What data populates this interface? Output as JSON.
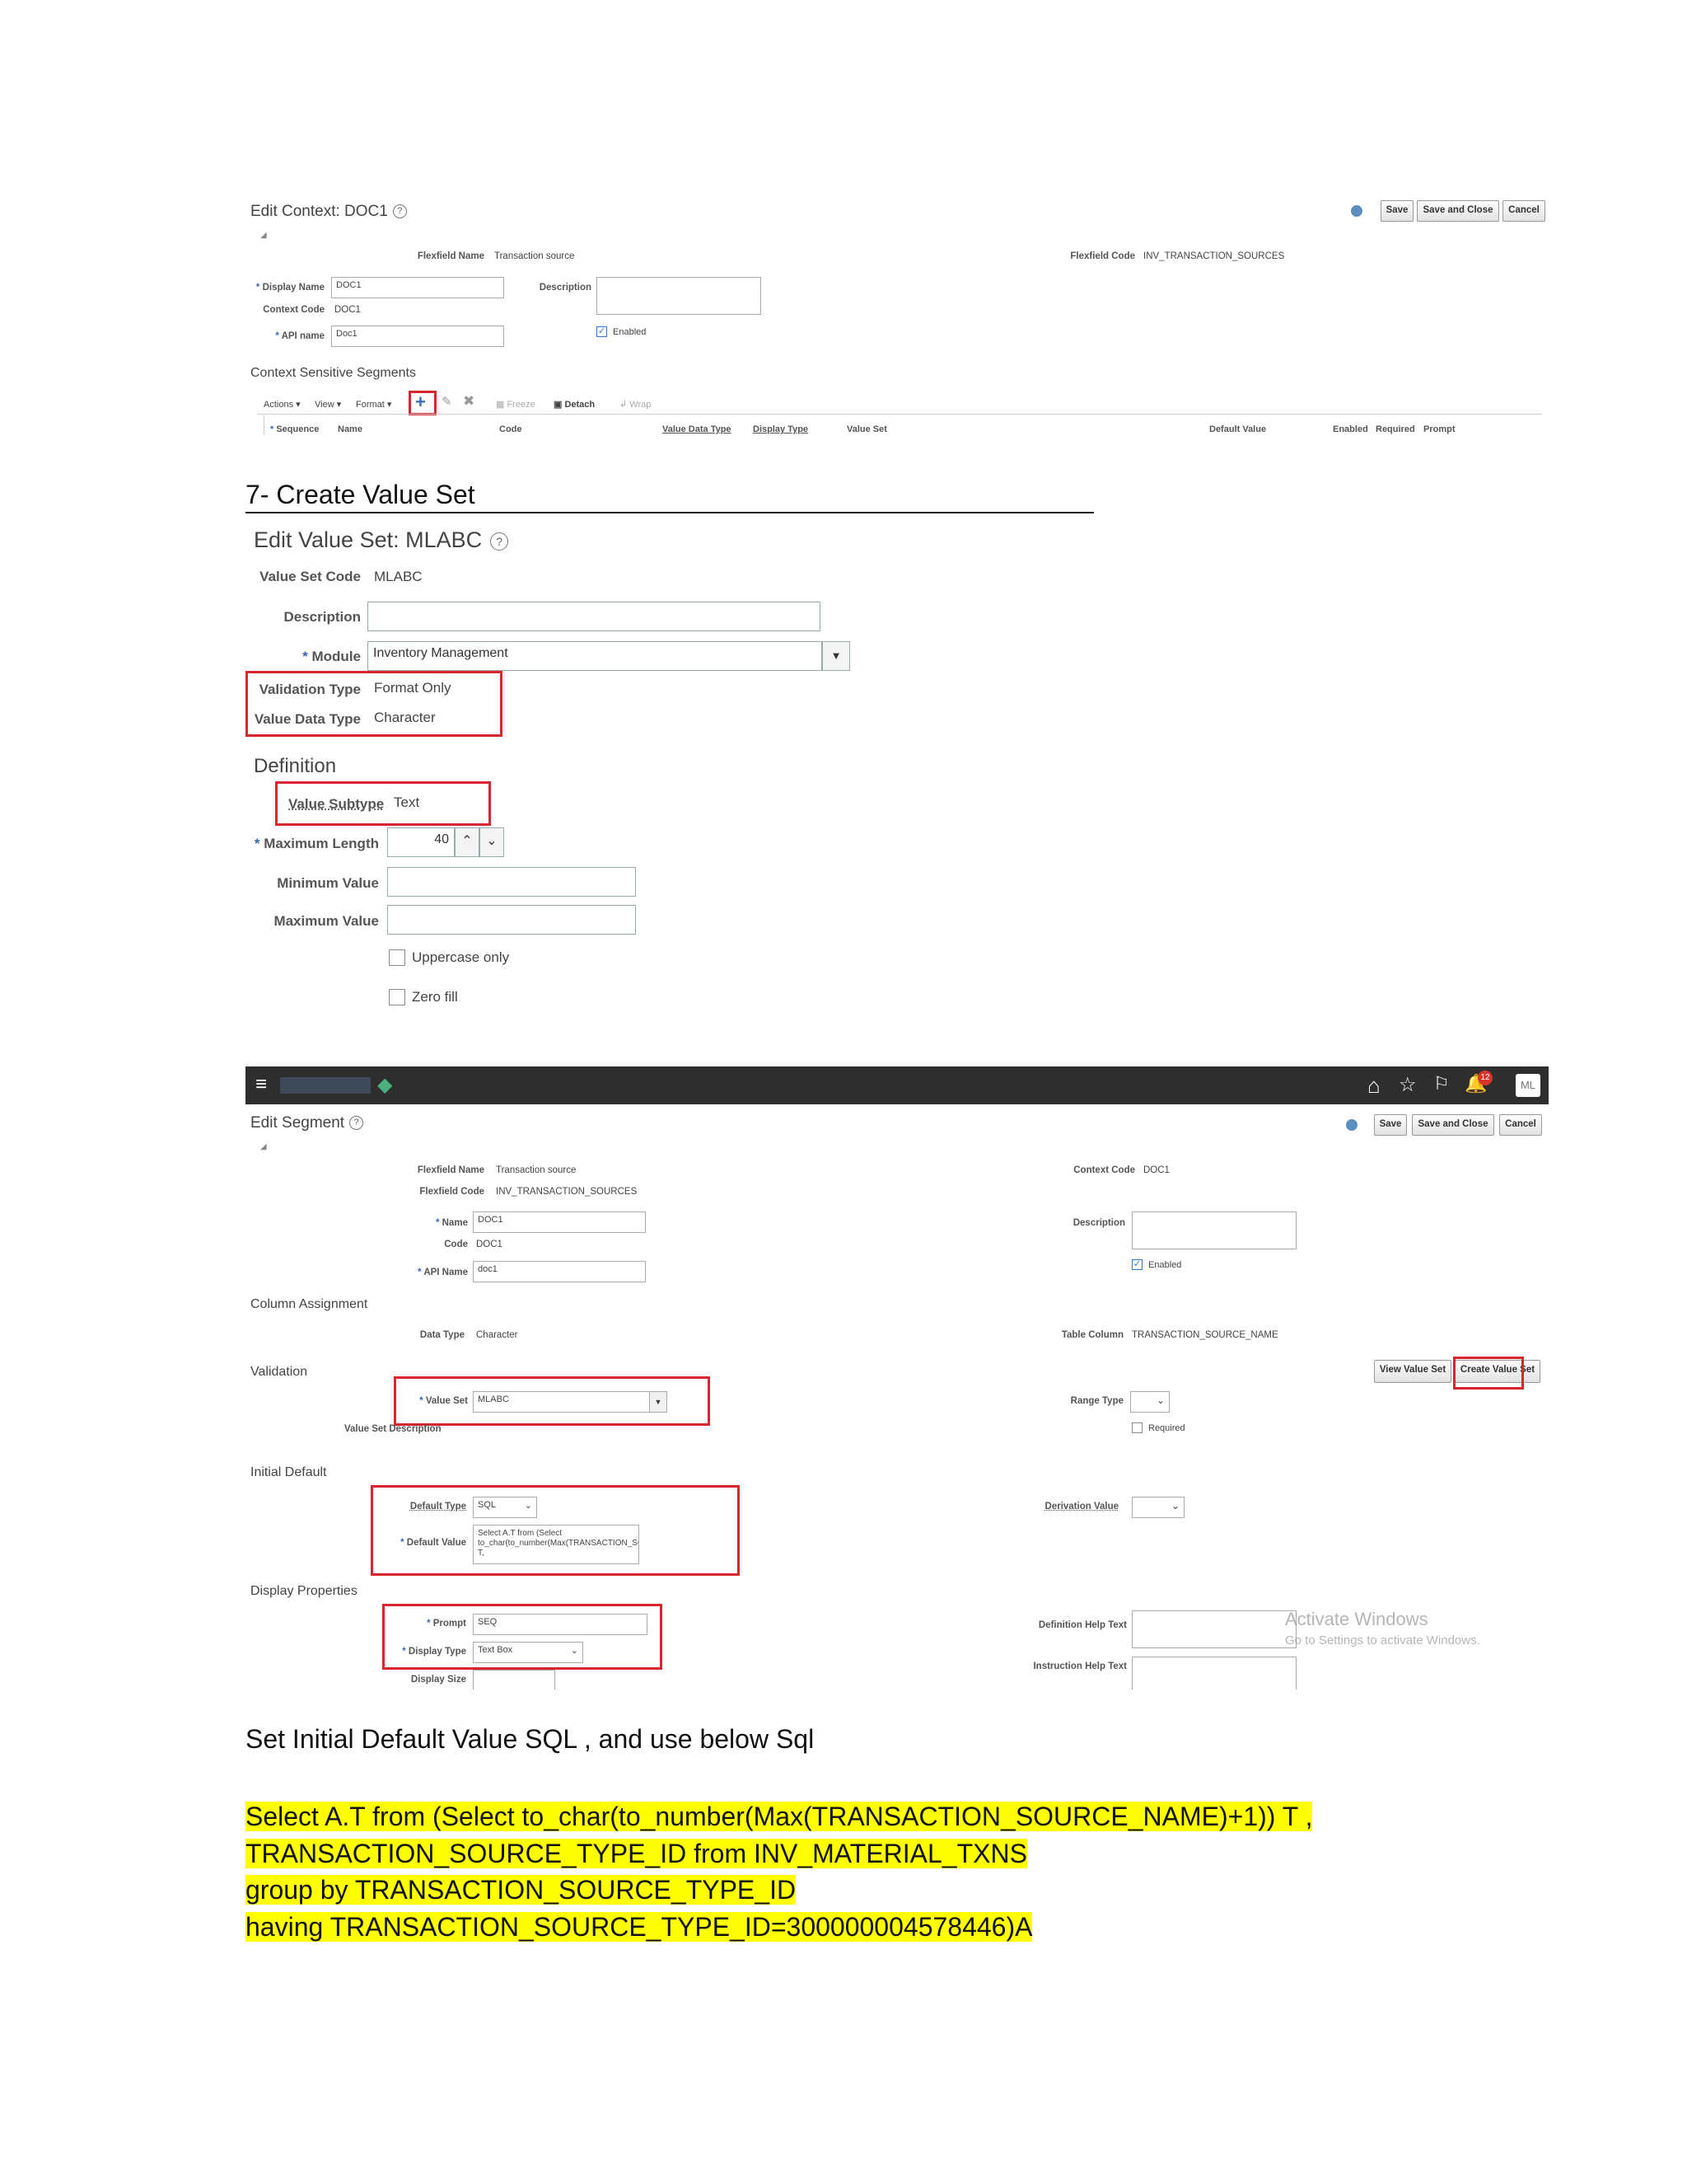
{
  "edit_context": {
    "title": "Edit Context: DOC1",
    "flexfield_name_label": "Flexfield Name",
    "flexfield_name": "Transaction source",
    "flexfield_code_label": "Flexfield Code",
    "flexfield_code": "INV_TRANSACTION_SOURCES",
    "display_name_label": "Display Name",
    "display_name": "DOC1",
    "context_code_label": "Context Code",
    "context_code": "DOC1",
    "api_name_label": "API name",
    "api_name": "Doc1",
    "description_label": "Description",
    "enabled_label": "Enabled",
    "save": "Save",
    "save_close": "Save and Close",
    "cancel": "Cancel",
    "segments_title": "Context Sensitive Segments",
    "toolbar": {
      "actions": "Actions",
      "view": "View",
      "format": "Format",
      "freeze": "Freeze",
      "detach": "Detach",
      "wrap": "Wrap"
    },
    "columns": [
      "Sequence",
      "Name",
      "Code",
      "Value Data Type",
      "Display Type",
      "Value Set",
      "Default Value",
      "Enabled",
      "Required",
      "Prompt"
    ]
  },
  "step7_heading": "7- Create Value Set",
  "value_set": {
    "title": "Edit Value Set: MLABC",
    "code_label": "Value Set Code",
    "code": "MLABC",
    "description_label": "Description",
    "module_label": "Module",
    "module": "Inventory Management",
    "validation_type_label": "Validation Type",
    "validation_type": "Format Only",
    "value_data_type_label": "Value Data Type",
    "value_data_type": "Character",
    "definition_title": "Definition",
    "value_subtype_label": "Value Subtype",
    "value_subtype": "Text",
    "max_length_label": "Maximum Length",
    "max_length": "40",
    "min_value_label": "Minimum Value",
    "max_value_label": "Maximum Value",
    "uppercase_label": "Uppercase only",
    "zero_fill_label": "Zero fill"
  },
  "edit_segment": {
    "header_initials": "ML",
    "notification_count": "12",
    "title": "Edit Segment",
    "save": "Save",
    "save_close": "Save and Close",
    "cancel": "Cancel",
    "flexfield_name_label": "Flexfield Name",
    "flexfield_name": "Transaction source",
    "flexfield_code_label": "Flexfield Code",
    "flexfield_code": "INV_TRANSACTION_SOURCES",
    "context_code_label": "Context Code",
    "context_code": "DOC1",
    "name_label": "Name",
    "name": "DOC1",
    "code_label": "Code",
    "code": "DOC1",
    "api_name_label": "API Name",
    "api_name": "doc1",
    "description_label": "Description",
    "enabled_label": "Enabled",
    "column_assignment_title": "Column Assignment",
    "data_type_label": "Data Type",
    "data_type": "Character",
    "table_column_label": "Table Column",
    "table_column": "TRANSACTION_SOURCE_NAME",
    "validation_title": "Validation",
    "view_value_set": "View Value Set",
    "create_value_set": "Create Value Set",
    "value_set_label": "Value Set",
    "value_set": "MLABC",
    "value_set_desc_label": "Value Set Description",
    "range_type_label": "Range Type",
    "required_label": "Required",
    "initial_default_title": "Initial Default",
    "default_type_label": "Default Type",
    "default_type": "SQL",
    "default_value_label": "Default Value",
    "default_value": "Select A.T from (Select to_char(to_number(Max(TRANSACTION_SOURCE_NAME)+1)) T,",
    "derivation_value_label": "Derivation Value",
    "display_properties_title": "Display Properties",
    "prompt_label": "Prompt",
    "prompt": "SEQ",
    "display_type_label": "Display Type",
    "display_type": "Text Box",
    "display_size_label": "Display Size",
    "definition_help_label": "Definition Help Text",
    "instruction_help_label": "Instruction Help Text",
    "watermark_title": "Activate Windows",
    "watermark_sub": "Go to Settings to activate Windows."
  },
  "instruction": "Set Initial Default Value SQL , and use below Sql",
  "sql_lines": [
    "Select A.T from (Select  to_char(to_number(Max(TRANSACTION_SOURCE_NAME)+1)) T ,",
    "TRANSACTION_SOURCE_TYPE_ID from INV_MATERIAL_TXNS",
    "group by TRANSACTION_SOURCE_TYPE_ID",
    "having TRANSACTION_SOURCE_TYPE_ID=300000004578446)A"
  ]
}
